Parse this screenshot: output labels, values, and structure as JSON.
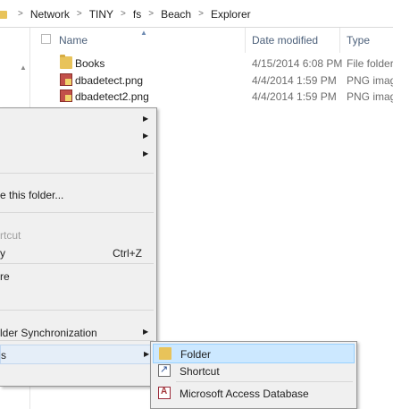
{
  "address_bar": {
    "breadcrumbs": [
      "Network",
      "TINY",
      "fs",
      "Beach",
      "Explorer"
    ],
    "separator": ">"
  },
  "columns": {
    "name": "Name",
    "date_modified": "Date modified",
    "type": "Type"
  },
  "files": [
    {
      "name": "Books",
      "date": "4/15/2014 6:08 PM",
      "type": "File folder",
      "icon": "folder-icon"
    },
    {
      "name": "dbadetect.png",
      "date": "4/4/2014 1:59 PM",
      "type": "PNG imag",
      "icon": "png-file-icon"
    },
    {
      "name": "dbadetect2.png",
      "date": "4/4/2014 1:59 PM",
      "type": "PNG imag",
      "icon": "png-file-icon"
    }
  ],
  "context_menu": {
    "items": [
      {
        "label": "",
        "arrow": "▶"
      },
      {
        "label": "",
        "arrow": "▶"
      },
      {
        "label": "",
        "arrow": "▶"
      },
      {
        "label": "e this folder..."
      },
      {
        "label": "rtcut"
      },
      {
        "label": "y",
        "shortcut": "Ctrl+Z"
      },
      {
        "label": "re"
      },
      {
        "label": "lder Synchronization",
        "arrow": "▶"
      },
      {
        "label": "s",
        "arrow": "▶"
      }
    ]
  },
  "submenu": {
    "items": [
      {
        "label": "Folder",
        "icon": "folder-icon"
      },
      {
        "label": "Shortcut",
        "icon": "shortcut-icon"
      },
      {
        "label": "Microsoft Access Database",
        "icon": "access-database-icon"
      }
    ]
  },
  "colors": {
    "header_text": "#4c607a",
    "menu_bg": "#f0f0f0",
    "submenu_highlight": "#cce8ff",
    "folder": "#e8c35a"
  }
}
